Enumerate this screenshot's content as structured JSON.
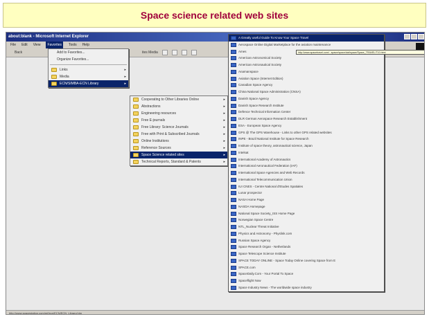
{
  "slide": {
    "title": "Space science related web sites"
  },
  "browser": {
    "window_title": "about:blank - Microsoft Internet Explorer",
    "menubar": [
      "File",
      "Edit",
      "View",
      "Favorites",
      "Tools",
      "Help"
    ],
    "active_menu": "Favorites",
    "toolbar_text": "Back",
    "toolbar_right": "ites  Media",
    "status_text": "http://www.spacestation.com/ref/ecn/ECN/ECN_Library.htm"
  },
  "favorites_menu": {
    "items": [
      {
        "label": "Add to Favorites...",
        "icon": "none"
      },
      {
        "label": "Organize Favorites...",
        "icon": "none"
      },
      {
        "separator": true
      },
      {
        "label": "Links",
        "icon": "folder-icon",
        "submenu": true
      },
      {
        "label": "Media",
        "icon": "folder-icon",
        "submenu": true
      },
      {
        "label": "ECN/SIMBA-ECN Library",
        "icon": "folder-icon",
        "submenu": true,
        "highlight": true
      }
    ]
  },
  "ecn_menu": {
    "items": [
      {
        "label": "Cooperating to Other Libraries Online",
        "highlight": false
      },
      {
        "label": "Abstractions",
        "highlight": false
      },
      {
        "label": "Engineering resources",
        "highlight": false
      },
      {
        "label": "Free E-journals",
        "highlight": false
      },
      {
        "label": "Free Library: Science Journals",
        "highlight": false
      },
      {
        "label": "Free with Print & Subscribed Journals",
        "highlight": false
      },
      {
        "label": "Online Institutions",
        "highlight": false
      },
      {
        "label": "Reference Sources",
        "highlight": false
      },
      {
        "label": "Space Science related sites",
        "highlight": true
      },
      {
        "label": "Technical Reports, Standard & Patents",
        "highlight": false
      }
    ]
  },
  "ssw_menu": {
    "items": [
      {
        "label": "A Greatly useful Guide To Know Your Space Travel",
        "highlight": true
      },
      {
        "label": "Aerospace Online Digital Marketplace for the aviation maintenance",
        "highlight": false
      },
      {
        "label": "Ames",
        "highlight": false
      },
      {
        "label": "American Astronomical Society",
        "highlight": false
      },
      {
        "label": "American Astronautical Society",
        "highlight": false
      },
      {
        "label": "Anamanspace",
        "highlight": false
      },
      {
        "label": "Aviation Space (Internet Edition)",
        "highlight": false
      },
      {
        "label": "Canadian Space Agency",
        "highlight": false
      },
      {
        "label": "China National Space Administration (CNSA)",
        "highlight": false
      },
      {
        "label": "Danish Space Agency",
        "highlight": false
      },
      {
        "label": "Danish Space Research Institute",
        "highlight": false
      },
      {
        "label": "Defence Technical Information Center",
        "highlight": false
      },
      {
        "label": "DLR German Aerospace Research Establishment",
        "highlight": false
      },
      {
        "label": "ESA - European Space Agency",
        "highlight": false
      },
      {
        "label": "GPS @ The GPS Warehouse - Links to other GPS related websites",
        "highlight": false
      },
      {
        "label": "INPE - Brazil National Institute for Space Research",
        "highlight": false
      },
      {
        "label": "Institute of space theory, astronautical science, Japan",
        "highlight": false
      },
      {
        "label": "Intelsat",
        "highlight": false
      },
      {
        "label": "International Academy of Astronautics",
        "highlight": false
      },
      {
        "label": "International Aeronautical Federation (IAF)",
        "highlight": false
      },
      {
        "label": "International Space Agencies and Web Records",
        "highlight": false
      },
      {
        "label": "International Telecommunication Union",
        "highlight": false
      },
      {
        "label": "IUI CNES - Centre National d'Etudes Spatiales",
        "highlight": false
      },
      {
        "label": "Lunar prospector",
        "highlight": false
      },
      {
        "label": "NASA Home Page",
        "highlight": false
      },
      {
        "label": "NASDA Homepage",
        "highlight": false
      },
      {
        "label": "National Space Society_ISS Home Page",
        "highlight": false
      },
      {
        "label": "Norwegian Space Centre",
        "highlight": false
      },
      {
        "label": "NTL_Nuclear Threat Initiative",
        "highlight": false
      },
      {
        "label": "Physics and Astronomy - Physlink.com",
        "highlight": false
      },
      {
        "label": "Russian Space Agency",
        "highlight": false
      },
      {
        "label": "Space Research Organ - Netherlands",
        "highlight": false
      },
      {
        "label": "Space Telescope Science Institute",
        "highlight": false
      },
      {
        "label": "SPACE TODAY ONLINE - Space Today Online covering Space from E",
        "highlight": false
      },
      {
        "label": "SPACE.com",
        "highlight": false
      },
      {
        "label": "SpaceDaily.Com - Your Portal To Space",
        "highlight": false
      },
      {
        "label": "Spaceflight Now",
        "highlight": false
      },
      {
        "label": "Space Industry News - The worldwide space industry",
        "highlight": false
      }
    ]
  },
  "tooltip": {
    "text": "http://www.spacetravel.com/...space/space/dat/space/Space_TRAVEL/T10.html"
  },
  "colors": {
    "slide_header_bg": "#ffffc0",
    "slide_title": "#a0003c",
    "menu_highlight": "#0a246a",
    "folder": "#f4d35e"
  }
}
